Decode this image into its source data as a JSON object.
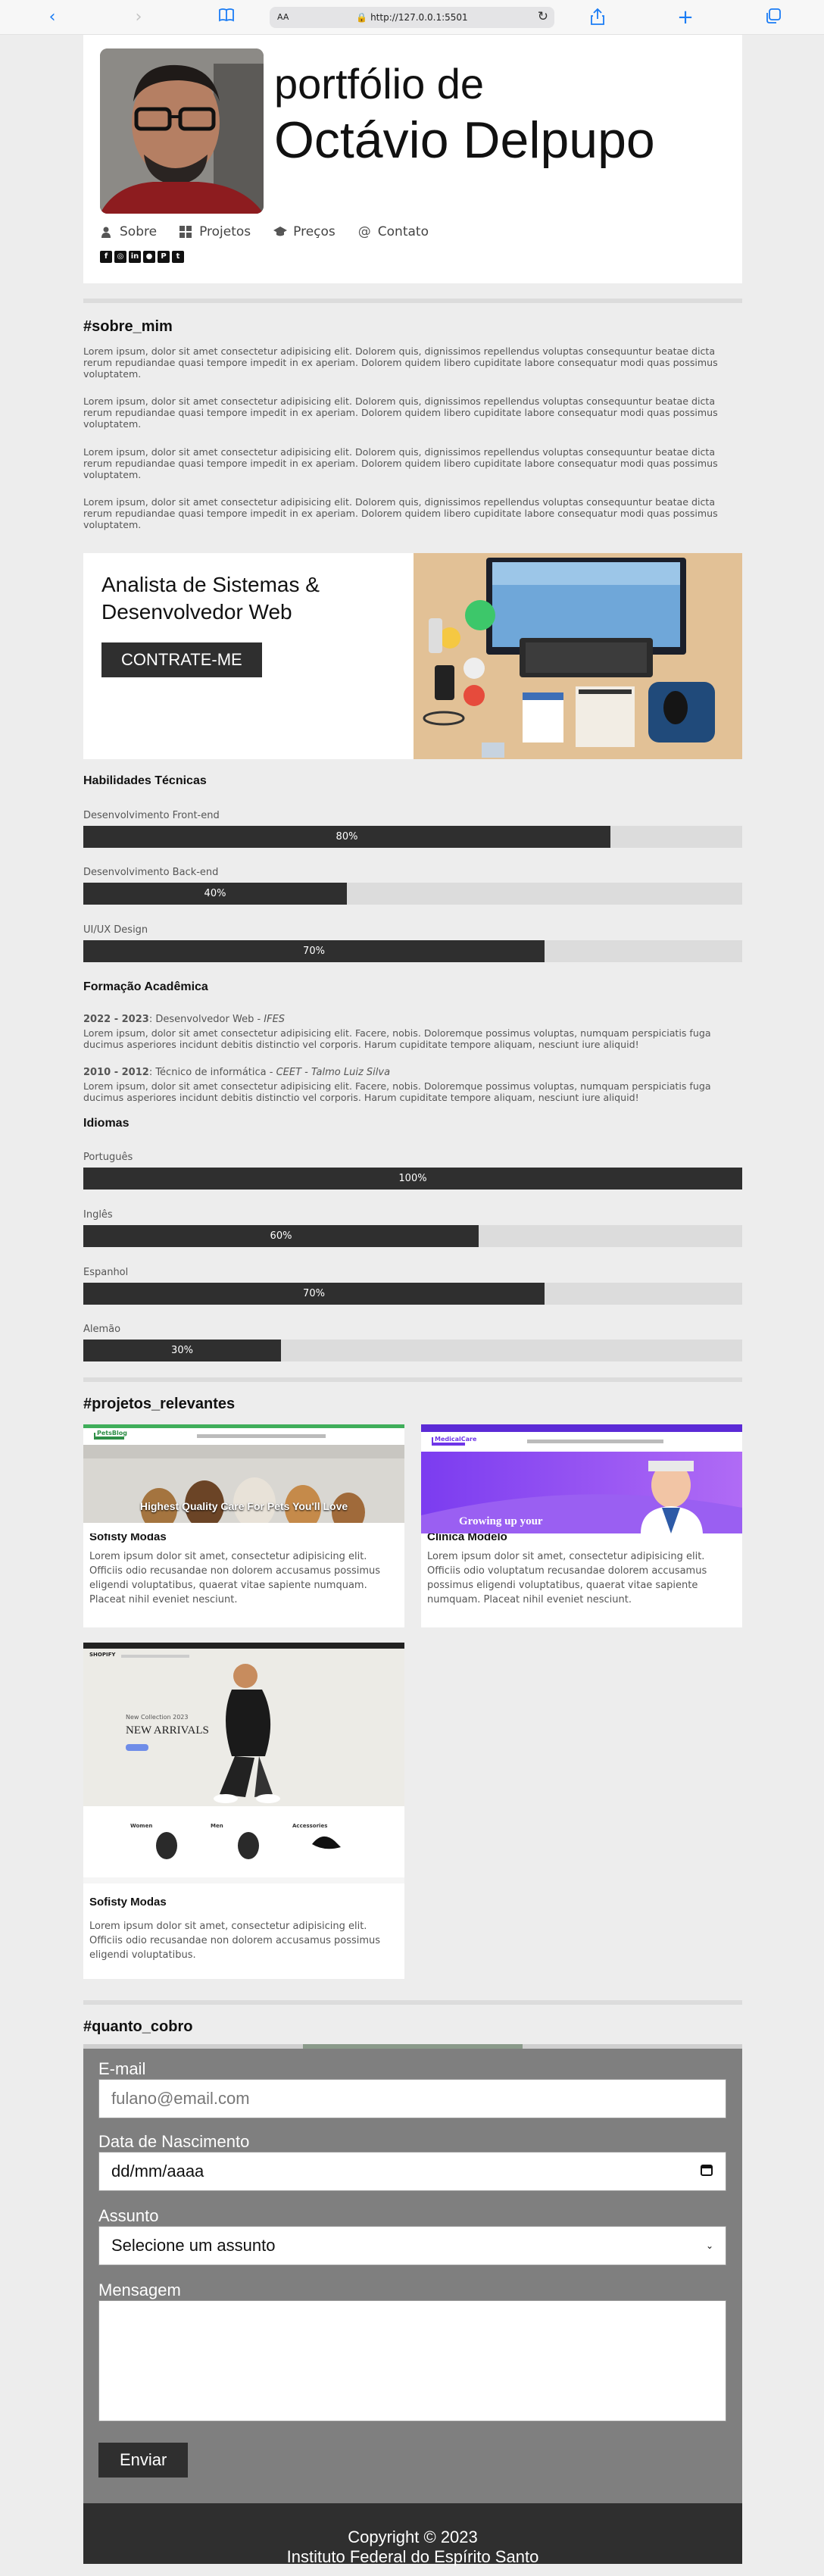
{
  "browser": {
    "url": "http://127.0.0.1:5501",
    "text_size_label": "AA"
  },
  "header": {
    "title_line1": "portfólio de",
    "title_line2": "Octávio Delpupo",
    "nav": [
      {
        "label": "Sobre",
        "icon": "user-icon"
      },
      {
        "label": "Projetos",
        "icon": "grid-icon"
      },
      {
        "label": "Preços",
        "icon": "graduation-cap-icon"
      },
      {
        "label": "Contato",
        "icon": "at-icon"
      }
    ],
    "social": [
      "facebook-icon",
      "instagram-icon",
      "linkedin-icon",
      "github-icon",
      "pinterest-icon",
      "twitter-icon"
    ]
  },
  "about": {
    "heading": "#sobre_mim",
    "paragraphs": [
      "Lorem ipsum, dolor sit amet consectetur adipisicing elit. Dolorem quis, dignissimos repellendus voluptas consequuntur beatae dicta rerum repudiandae quasi tempore impedit in ex aperiam. Dolorem quidem libero cupiditate labore consequatur modi quas possimus voluptatem.",
      "Lorem ipsum, dolor sit amet consectetur adipisicing elit. Dolorem quis, dignissimos repellendus voluptas consequuntur beatae dicta rerum repudiandae quasi tempore impedit in ex aperiam. Dolorem quidem libero cupiditate labore consequatur modi quas possimus voluptatem.",
      "Lorem ipsum, dolor sit amet consectetur adipisicing elit. Dolorem quis, dignissimos repellendus voluptas consequuntur beatae dicta rerum repudiandae quasi tempore impedit in ex aperiam. Dolorem quidem libero cupiditate labore consequatur modi quas possimus voluptatem.",
      "Lorem ipsum, dolor sit amet consectetur adipisicing elit. Dolorem quis, dignissimos repellendus voluptas consequuntur beatae dicta rerum repudiandae quasi tempore impedit in ex aperiam. Dolorem quidem libero cupiditate labore consequatur modi quas possimus voluptatem."
    ],
    "hire": {
      "title_line1": "Analista de Sistemas &",
      "title_line2": "Desenvolvedor Web",
      "button": "CONTRATE-ME"
    }
  },
  "skills": {
    "heading": "Habilidades Técnicas",
    "items": [
      {
        "label": "Desenvolvimento Front-end",
        "percent": 80,
        "text": "80%"
      },
      {
        "label": "Desenvolvimento Back-end",
        "percent": 40,
        "text": "40%"
      },
      {
        "label": "UI/UX Design",
        "percent": 70,
        "text": "70%"
      }
    ]
  },
  "education": {
    "heading": "Formação Acadêmica",
    "items": [
      {
        "years": "2022 - 2023",
        "course": ": Desenvolvedor Web - ",
        "school": "IFES",
        "desc": "Lorem ipsum, dolor sit amet consectetur adipisicing elit. Facere, nobis. Doloremque possimus voluptas, numquam perspiciatis fuga ducimus asperiores incidunt debitis distinctio vel corporis. Harum cupiditate tempore aliquam, nesciunt iure aliquid!"
      },
      {
        "years": "2010 - 2012",
        "course": ": Técnico de informática - ",
        "school": "CEET - Talmo Luiz Silva",
        "desc": "Lorem ipsum, dolor sit amet consectetur adipisicing elit. Facere, nobis. Doloremque possimus voluptas, numquam perspiciatis fuga ducimus asperiores incidunt debitis distinctio vel corporis. Harum cupiditate tempore aliquam, nesciunt iure aliquid!"
      }
    ]
  },
  "languages": {
    "heading": "Idiomas",
    "items": [
      {
        "label": "Português",
        "percent": 100,
        "text": "100%"
      },
      {
        "label": "Inglês",
        "percent": 60,
        "text": "60%"
      },
      {
        "label": "Espanhol",
        "percent": 70,
        "text": "70%"
      },
      {
        "label": "Alemão",
        "percent": 30,
        "text": "30%"
      }
    ]
  },
  "projects": {
    "heading": "#projetos_relevantes",
    "items": [
      {
        "name": "Sofisty Modas",
        "thumb_caption": "Highest Quality Care For Pets You'll Love",
        "thumb_brand": "PetsBlog",
        "desc": "Lorem ipsum dolor sit amet, consectetur adipisicing elit. Officiis odio recusandae non dolorem accusamus possimus eligendi voluptatibus, quaerat vitae sapiente numquam. Placeat nihil eveniet nesciunt."
      },
      {
        "name": "Clínica Modelo",
        "thumb_caption": "Growing up your",
        "thumb_brand": "MedicalCare",
        "desc": "Lorem ipsum dolor sit amet, consectetur adipisicing elit. Officiis odio voluptatum recusandae dolorem accusamus possimus eligendi voluptatibus, quaerat vitae sapiente numquam. Placeat nihil eveniet nesciunt."
      },
      {
        "name": "Sofisty Modas",
        "thumb_caption": "NEW ARRIVALS",
        "thumb_subcaption": "New Collection 2023",
        "thumb_brand": "SHOPIFY",
        "categories": [
          "Women",
          "Men",
          "Accessories"
        ],
        "desc": "Lorem ipsum dolor sit amet, consectetur adipisicing elit. Officiis odio recusandae non dolorem accusamus possimus eligendi voluptatibus."
      }
    ]
  },
  "pricing": {
    "heading": "#quanto_cobro"
  },
  "contact": {
    "email_label": "E-mail",
    "email_placeholder": "fulano@email.com",
    "birth_label": "Data de Nascimento",
    "birth_placeholder": "dd/mm/aaaa",
    "subject_label": "Assunto",
    "subject_selected": "Selecione um assunto",
    "message_label": "Mensagem",
    "send_button": "Enviar"
  },
  "footer": {
    "copyright": "Copyright © 2023",
    "institution": "Instituto Federal do Espírito Santo"
  },
  "colors": {
    "accent_dark": "#2f2f2f",
    "bar_track": "#dcdcdc",
    "contact_bg": "#7f7f7f",
    "page_bg": "#ededed",
    "safari_blue": "#1a7cf5"
  }
}
